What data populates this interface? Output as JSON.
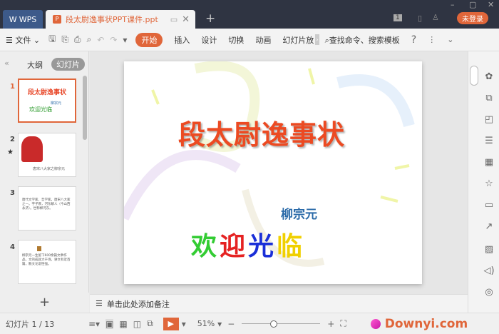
{
  "titlebar": {
    "wps_label": "WPS",
    "doc_title": "段太尉逸事状PPT课件.ppt",
    "new_tab": "+",
    "badge": "1",
    "login": "未登录"
  },
  "toolbar": {
    "menu_file": "文件",
    "start": "开始",
    "tabs": [
      "插入",
      "设计",
      "切换",
      "动画",
      "幻灯片放"
    ],
    "search": "查找命令、搜索模板",
    "help": "?"
  },
  "leftpanel": {
    "tab_outline": "大纲",
    "tab_slides": "幻灯片",
    "slides": [
      {
        "num": "1",
        "title": "段太尉逸事状",
        "author": "柳宗元",
        "welcome": "欢迎光临"
      },
      {
        "num": "2",
        "caption": "唐宋八大家之柳宗元"
      },
      {
        "num": "3",
        "text": "唐代文学家、哲学家，唐宋八大家之一。字子厚，河东解人（今山西永济）。世称柳河东。"
      },
      {
        "num": "4",
        "text": "柳宗元一生留下600余篇文章作品，文的成就大于诗。骈文有近百篇，散文论说性强。"
      }
    ]
  },
  "slide": {
    "title": "段太尉逸事状",
    "author": "柳宗元",
    "welcome": [
      "欢",
      "迎",
      "光",
      "临"
    ],
    "welcome_colors": [
      "#33cc33",
      "#e52222",
      "#1a2fd8",
      "#f0d000"
    ]
  },
  "notes": {
    "placeholder": "单击此处添加备注"
  },
  "status": {
    "slide_counter": "幻灯片 1 / 13",
    "zoom": "51%",
    "zoom_fraction": 0.4,
    "watermark": "Downyi.com"
  },
  "colors": {
    "accent": "#e0663a",
    "titlebar": "#2f3442"
  }
}
